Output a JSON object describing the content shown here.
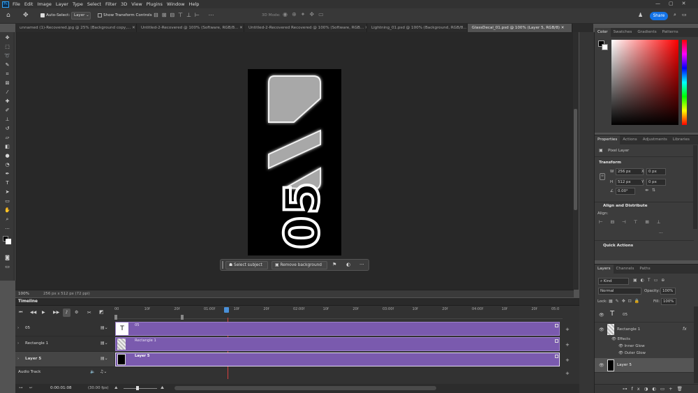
{
  "app": {
    "logo": "Ps"
  },
  "menu": [
    "File",
    "Edit",
    "Image",
    "Layer",
    "Type",
    "Select",
    "Filter",
    "3D",
    "View",
    "Plugins",
    "Window",
    "Help"
  ],
  "options": {
    "auto_select_label": "Auto-Select:",
    "auto_select_value": "Layer",
    "show_transform_label": "Show Transform Controls",
    "mode_3d_label": "3D Mode:",
    "share_label": "Share"
  },
  "tabs": [
    "unnamed (1)-Recovered.jpg @ 25% (Background copy,...",
    "Untitled-2-Recovered @ 100% (Software, RGB/8...",
    "Untitled-2-Recovered Recovered @ 100% (Software, RGB...",
    "Lightning_01.psd @ 100% (Background, RGB/8...",
    "GlassDecal_01.psd @ 100% (Layer 5, RGB/8)"
  ],
  "active_tab_index": 4,
  "canvas": {
    "decal_text": "05",
    "context_bar": {
      "select_subject": "Select subject",
      "remove_background": "Remove background",
      "more": "···"
    }
  },
  "status": {
    "zoom": "100%",
    "doc_info": "256 px x 512 px (72 ppi)"
  },
  "timeline": {
    "title": "Timeline",
    "ruler_labels": [
      "00",
      "10f",
      "20f",
      "01:00f",
      "10f",
      "20f",
      "02:00f",
      "10f",
      "20f",
      "03:00f",
      "10f",
      "20f",
      "04:00f",
      "10f",
      "20f",
      "05:0"
    ],
    "tracks": [
      {
        "name": "05",
        "clip": "05",
        "selected": false
      },
      {
        "name": "Rectangle 1",
        "clip": "Rectangle 1",
        "selected": false
      },
      {
        "name": "Layer 5",
        "clip": "Layer 5",
        "selected": true
      }
    ],
    "audio_track_label": "Audio Track",
    "timecode": "0:00:01:08",
    "fps": "(30.00 fps)"
  },
  "color_panel": {
    "tabs": [
      "Color",
      "Swatches",
      "Gradients",
      "Patterns"
    ],
    "active": 0,
    "hue_color": "#ff0000"
  },
  "properties_panel": {
    "tabs": [
      "Properties",
      "Actions",
      "Adjustments",
      "Libraries"
    ],
    "active": 0,
    "layer_type": "Pixel Layer",
    "transform_title": "Transform",
    "w_label": "W",
    "w_value": "256 px",
    "h_label": "H",
    "h_value": "512 px",
    "x_label": "X",
    "x_value": "0 px",
    "y_label": "Y",
    "y_value": "0 px",
    "angle_value": "0.00°",
    "align_title": "Align and Distribute",
    "align_label": "Align:",
    "quick_actions_title": "Quick Actions",
    "more": "···"
  },
  "layers_panel": {
    "tabs": [
      "Layers",
      "Channels",
      "Paths"
    ],
    "active": 0,
    "filter_kind": "Kind",
    "blend_mode": "Normal",
    "opacity_label": "Opacity:",
    "opacity_value": "100%",
    "lock_label": "Lock:",
    "fill_label": "Fill:",
    "fill_value": "100%",
    "layers": [
      {
        "name": "05",
        "kind": "text"
      },
      {
        "name": "Rectangle 1",
        "kind": "shape",
        "fx": "fx"
      },
      {
        "name": "Effects",
        "kind": "effects"
      },
      {
        "name": "Inner Glow",
        "kind": "effect"
      },
      {
        "name": "Outer Glow",
        "kind": "effect"
      },
      {
        "name": "Layer 5",
        "kind": "pixel",
        "selected": true
      }
    ]
  }
}
